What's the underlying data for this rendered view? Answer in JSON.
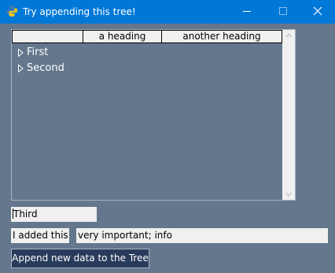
{
  "window": {
    "title": "Try appending this tree!",
    "titlebar_color": "#0078d7",
    "background_color": "#64778d",
    "icon": "python-icon"
  },
  "tree": {
    "columns": [
      "",
      "a heading",
      "another heading"
    ],
    "rows": [
      {
        "label": "First",
        "expander": "triangle-right-icon"
      },
      {
        "label": "Second",
        "expander": "triangle-right-icon"
      }
    ]
  },
  "form": {
    "new_item_value": "Third",
    "key_value": "I added this",
    "info_value": "very important; info",
    "append_label": "Append new data to the Tree"
  },
  "colors": {
    "button_bg": "#283b5b",
    "input_bg": "#f0f0f0"
  }
}
